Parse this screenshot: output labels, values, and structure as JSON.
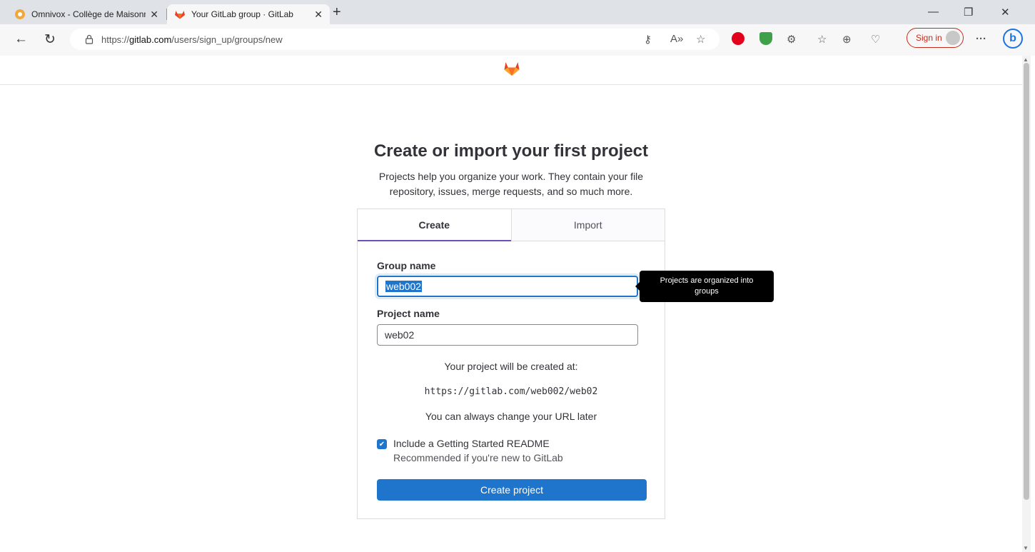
{
  "browser": {
    "tabs": [
      {
        "title": "Omnivox - Collège de Maisonneuve",
        "active": false
      },
      {
        "title": "Your GitLab group · GitLab",
        "active": true
      }
    ],
    "url_prefix": "https://",
    "url_host": "gitlab.com",
    "url_path": "/users/sign_up/groups/new",
    "sign_in_label": "Sign in",
    "bing_label": "b",
    "more_label": "···"
  },
  "page": {
    "title": "Create or import your first project",
    "subtitle": "Projects help you organize your work. They contain your file repository, issues, merge requests, and so much more.",
    "tabs": {
      "create": "Create",
      "import": "Import"
    },
    "group_name_label": "Group name",
    "group_name_value": "web002",
    "tooltip": "Projects are organized into groups",
    "project_name_label": "Project name",
    "project_name_value": "web02",
    "created_at_text": "Your project will be created at:",
    "created_at_url": "https://gitlab.com/web002/web02",
    "change_url_text": "You can always change your URL later",
    "readme_label": "Include a Getting Started README",
    "readme_checked": true,
    "readme_help": "Recommended if you're new to GitLab",
    "create_button": "Create project"
  },
  "colors": {
    "accent": "#1f75cb",
    "tab_active_border": "#6b4fbb",
    "gitlab_orange": "#fc6d26"
  }
}
